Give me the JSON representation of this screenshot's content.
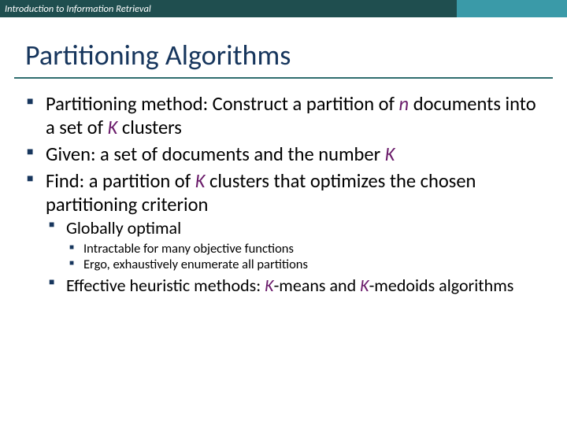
{
  "header": {
    "course": "Introduction to Information Retrieval"
  },
  "title": "Partitioning Algorithms",
  "bullets": {
    "b1_pre": "Partitioning method: Construct a partition of ",
    "b1_n": "n",
    "b1_mid": " documents into a set of ",
    "b1_K": "K",
    "b1_post": " clusters",
    "b2_pre": "Given: a set of documents and the number ",
    "b2_K": "K",
    "b3_pre": "Find: a partition of ",
    "b3_K": "K",
    "b3_post": " clusters that optimizes the chosen partitioning criterion",
    "sub1": "Globally optimal",
    "sub1a": "Intractable for many objective functions",
    "sub1b": "Ergo, exhaustively enumerate all partitions",
    "sub2_pre": "Effective heuristic methods: ",
    "sub2_K1": "K",
    "sub2_mid": "-means and ",
    "sub2_K2": "K",
    "sub2_post": "-medoids algorithms"
  }
}
